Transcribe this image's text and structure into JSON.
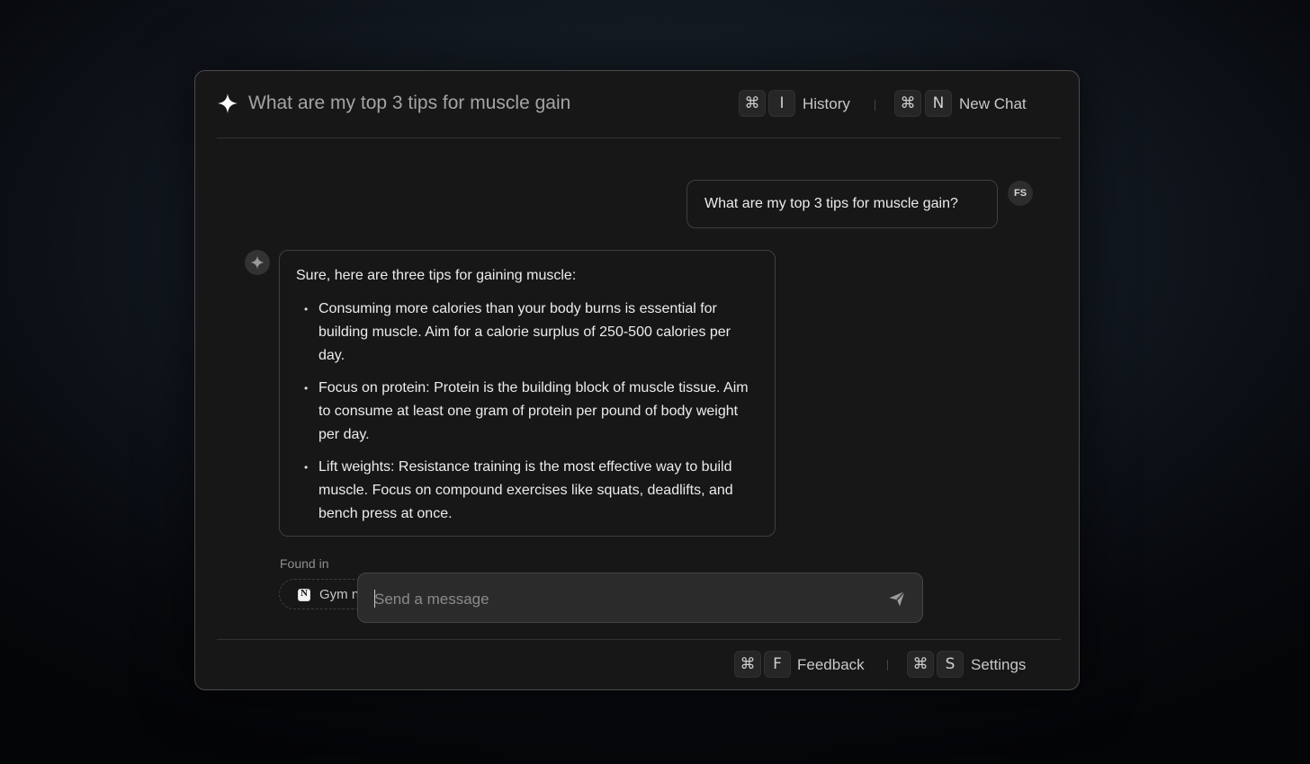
{
  "header": {
    "title": "What are my top 3 tips for muscle gain",
    "history": {
      "mod_key": "⌘",
      "key": "I",
      "label": "History"
    },
    "new_chat": {
      "mod_key": "⌘",
      "key": "N",
      "label": "New Chat"
    }
  },
  "conversation": {
    "user_initials": "FS",
    "user_message": "What are my top 3 tips for muscle gain?",
    "assistant_intro": "Sure, here are three tips for gaining muscle:",
    "assistant_tips": [
      "Consuming more calories than your body burns is essential for building muscle. Aim for a calorie surplus of 250-500 calories per day.",
      "Focus on protein: Protein is the building block of muscle tissue. Aim to consume at least one gram of protein per pound of body weight per day.",
      "Lift weights: Resistance training is the most effective way to build muscle. Focus on compound exercises like squats, deadlifts, and bench press at once."
    ],
    "found_in_label": "Found in",
    "source_label": "Gym n"
  },
  "composer": {
    "placeholder": "Send a message"
  },
  "footer": {
    "feedback": {
      "mod_key": "⌘",
      "key": "F",
      "label": "Feedback"
    },
    "settings": {
      "mod_key": "⌘",
      "key": "S",
      "label": "Settings"
    }
  },
  "icons": {
    "header": "sparkle-icon",
    "assistant": "sparkle-icon",
    "source": "notion-icon",
    "send": "send-icon"
  },
  "colors": {
    "background": "#0b0e13",
    "panel": "#171717",
    "border": "#4a4a4a",
    "input_bg": "#2b2b2b"
  }
}
